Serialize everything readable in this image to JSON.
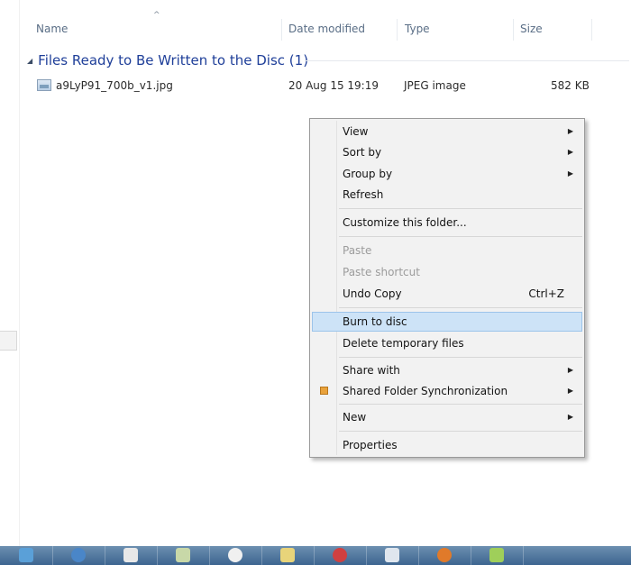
{
  "columns": {
    "name": "Name",
    "date_modified": "Date modified",
    "type": "Type",
    "size": "Size"
  },
  "group": {
    "title": "Files Ready to Be Written to the Disc (1)"
  },
  "file": {
    "name": "a9LyP91_700b_v1.jpg",
    "date_modified": "20 Aug 15 19:19",
    "type": "JPEG image",
    "size": "582 KB"
  },
  "context_menu": {
    "view": "View",
    "sort_by": "Sort by",
    "group_by": "Group by",
    "refresh": "Refresh",
    "customize": "Customize this folder...",
    "paste": "Paste",
    "paste_shortcut": "Paste shortcut",
    "undo_copy": "Undo Copy",
    "undo_shortcut": "Ctrl+Z",
    "burn_to_disc": "Burn to disc",
    "delete_temp": "Delete temporary files",
    "share_with": "Share with",
    "shared_sync": "Shared Folder Synchronization",
    "new": "New",
    "properties": "Properties"
  },
  "colors": {
    "menu_highlight": "#cde3f7",
    "group_header": "#1f3f99",
    "taskbar": "#3d6590"
  },
  "taskbar_icons": [
    "start-icon",
    "ie-icon",
    "paint-icon",
    "app-icon",
    "folder-icon",
    "acrobat-icon",
    "notes-icon",
    "firefox-icon",
    "app2-icon"
  ]
}
